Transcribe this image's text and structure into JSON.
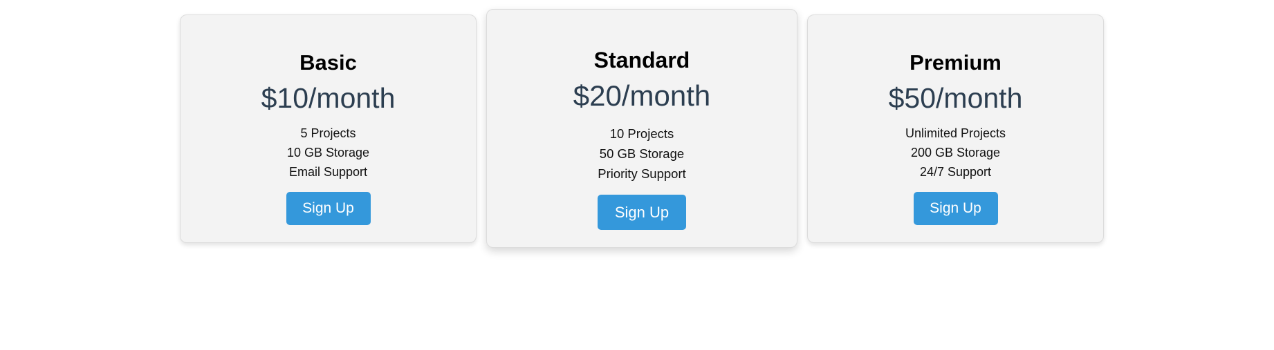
{
  "plans": [
    {
      "name": "Basic",
      "price": "$10/month",
      "features": [
        "5 Projects",
        "10 GB Storage",
        "Email Support"
      ],
      "button_label": "Sign Up"
    },
    {
      "name": "Standard",
      "price": "$20/month",
      "features": [
        "10 Projects",
        "50 GB Storage",
        "Priority Support"
      ],
      "button_label": "Sign Up"
    },
    {
      "name": "Premium",
      "price": "$50/month",
      "features": [
        "Unlimited Projects",
        "200 GB Storage",
        "24/7 Support"
      ],
      "button_label": "Sign Up"
    }
  ],
  "colors": {
    "card_background": "#f3f3f3",
    "button_background": "#3498db",
    "price_text": "#2c3e50"
  }
}
